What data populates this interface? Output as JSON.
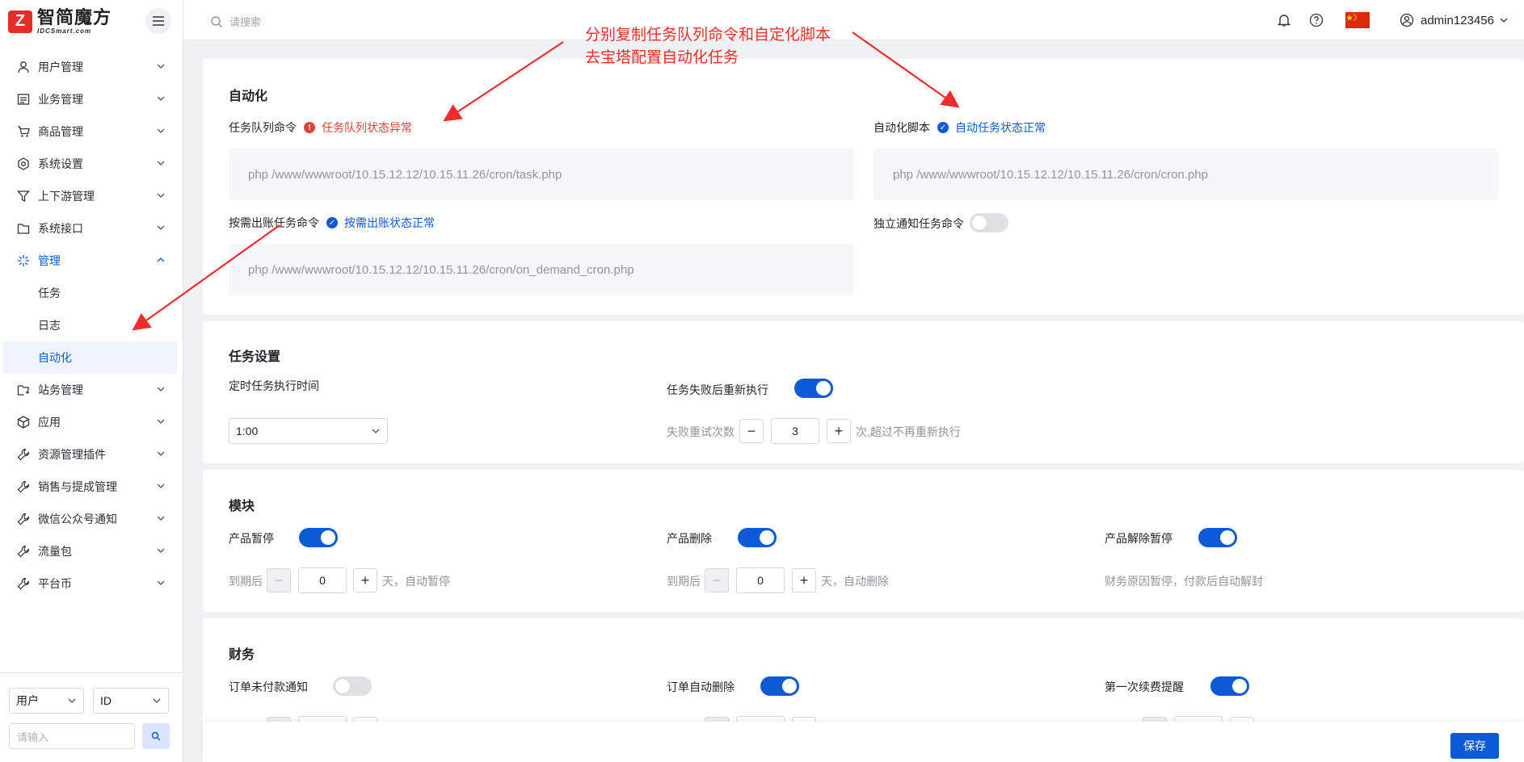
{
  "brand": {
    "name_cn": "智简魔方",
    "name_en": "IDCSmart.com",
    "logo_letter": "Z"
  },
  "header": {
    "search_placeholder": "请搜索",
    "username": "admin123456"
  },
  "sidebar": {
    "items": [
      {
        "label": "用户管理",
        "icon": "user-icon"
      },
      {
        "label": "业务管理",
        "icon": "list-icon"
      },
      {
        "label": "商品管理",
        "icon": "cart-icon"
      },
      {
        "label": "系统设置",
        "icon": "settings-icon"
      },
      {
        "label": "上下游管理",
        "icon": "filter-icon"
      },
      {
        "label": "系统接口",
        "icon": "folder-icon"
      },
      {
        "label": "管理",
        "icon": "sparkle-icon"
      },
      {
        "label": "站务管理",
        "icon": "station-icon"
      },
      {
        "label": "应用",
        "icon": "cube-icon"
      },
      {
        "label": "资源管理插件",
        "icon": "wrench-icon"
      },
      {
        "label": "销售与提成管理",
        "icon": "wrench-icon"
      },
      {
        "label": "微信公众号通知",
        "icon": "wrench-icon"
      },
      {
        "label": "流量包",
        "icon": "wrench-icon"
      },
      {
        "label": "平台币",
        "icon": "wrench-icon"
      }
    ],
    "sub_items": [
      "任务",
      "日志",
      "自动化"
    ],
    "filter": {
      "type_value": "用户",
      "field_value": "ID",
      "input_placeholder": "请输入"
    }
  },
  "annotation": {
    "line1": "分别复制任务队列命令和自定化脚本",
    "line2": "去宝塔配置自动化任务"
  },
  "automation": {
    "title": "自动化",
    "queue_label": "任务队列命令",
    "queue_status": "任务队列状态异常",
    "queue_cmd": "php /www/wwwroot/10.15.12.12/10.15.11.26/cron/task.php",
    "script_label": "自动化脚本",
    "script_status": "自动任务状态正常",
    "script_cmd": "php /www/wwwroot/10.15.12.12/10.15.11.26/cron/cron.php",
    "billing_label": "按需出账任务命令",
    "billing_status": "按需出账状态正常",
    "billing_cmd": "php /www/wwwroot/10.15.12.12/10.15.11.26/cron/on_demand_cron.php",
    "notify_label": "独立通知任务命令",
    "notify_on": false
  },
  "task_settings": {
    "title": "任务设置",
    "time_label": "定时任务执行时间",
    "time_value": "1:00",
    "retry_label": "任务失败后重新执行",
    "retry_on": true,
    "retry_count_label": "失败重试次数",
    "retry_count": "3",
    "retry_suffix": "次,超过不再重新执行"
  },
  "module": {
    "title": "模块",
    "suspend_label": "产品暂停",
    "suspend_on": true,
    "suspend_prefix": "到期后",
    "suspend_days": "0",
    "suspend_suffix": "天，自动暂停",
    "delete_label": "产品删除",
    "delete_on": true,
    "delete_prefix": "到期后",
    "delete_days": "0",
    "delete_suffix": "天，自动删除",
    "unsuspend_label": "产品解除暂停",
    "unsuspend_on": true,
    "unsuspend_hint": "财务原因暂停，付款后自动解封"
  },
  "finance": {
    "title": "财务",
    "unpaid_label": "订单未付款通知",
    "unpaid_on": false,
    "autodel_label": "订单自动删除",
    "autodel_on": true,
    "renew_label": "第一次续费提醒",
    "renew_on": true
  },
  "footer": {
    "save_label": "保存"
  },
  "colors": {
    "accent": "#0d5ad6",
    "error": "#e0413a",
    "annotation": "#ef2b2b"
  }
}
